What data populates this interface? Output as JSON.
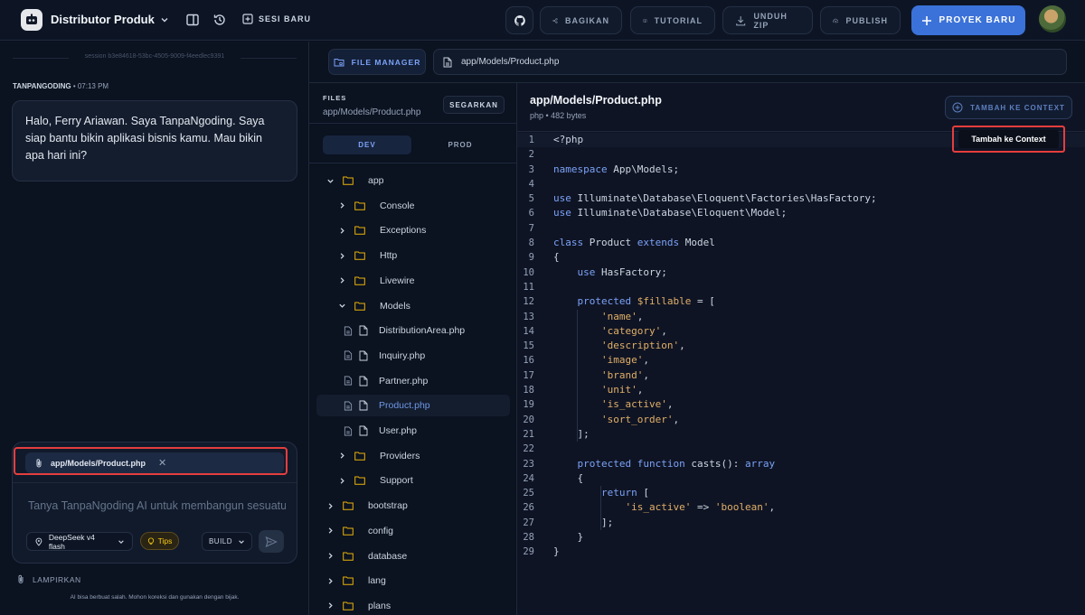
{
  "topbar": {
    "project_title": "Distributor Produk",
    "new_session": "SESI BARU",
    "share": "BAGIKAN",
    "tutorial": "TUTORIAL",
    "download_zip": "UNDUH ZIP",
    "publish": "PUBLISH",
    "new_project": "PROYEK BARU"
  },
  "chat": {
    "session_id": "session b3e84618-53bc-4505-9009-f4eedlec9391",
    "sender": "TANPANGODING",
    "time": "• 07:13 PM",
    "message": "Halo, Ferry Ariawan. Saya TanpaNgoding. Saya siap bantu bikin aplikasi bisnis kamu. Mau bikin apa hari ini?",
    "attachment": "app/Models/Product.php",
    "input_placeholder": "Tanya TanpaNgoding AI untuk membangun sesuatu...",
    "model": "DeepSeek v4 flash",
    "tips": "Tips",
    "mode": "BUILD",
    "attach_label": "LAMPIRKAN",
    "disclaimer": "AI bisa berbuat salah. Mohon koreksi dan gunakan dengan bijak."
  },
  "file_manager": {
    "tab": "FILE MANAGER",
    "path": "app/Models/Product.php",
    "files_label": "FILES",
    "files_path": "app/Models/Product.php",
    "refresh": "SEGARKAN",
    "env_dev": "DEV",
    "env_prod": "PROD",
    "tree": [
      {
        "name": "app",
        "type": "folder",
        "open": true,
        "depth": 0
      },
      {
        "name": "Console",
        "type": "folder",
        "open": false,
        "depth": 1
      },
      {
        "name": "Exceptions",
        "type": "folder",
        "open": false,
        "depth": 1
      },
      {
        "name": "Http",
        "type": "folder",
        "open": false,
        "depth": 1
      },
      {
        "name": "Livewire",
        "type": "folder",
        "open": false,
        "depth": 1
      },
      {
        "name": "Models",
        "type": "folder",
        "open": true,
        "depth": 1
      },
      {
        "name": "DistributionArea.php",
        "type": "file",
        "depth": 2
      },
      {
        "name": "Inquiry.php",
        "type": "file",
        "depth": 2
      },
      {
        "name": "Partner.php",
        "type": "file",
        "depth": 2
      },
      {
        "name": "Product.php",
        "type": "file",
        "depth": 2,
        "active": true
      },
      {
        "name": "User.php",
        "type": "file",
        "depth": 2
      },
      {
        "name": "Providers",
        "type": "folder",
        "open": false,
        "depth": 1
      },
      {
        "name": "Support",
        "type": "folder",
        "open": false,
        "depth": 1
      },
      {
        "name": "bootstrap",
        "type": "folder",
        "open": false,
        "depth": 0
      },
      {
        "name": "config",
        "type": "folder",
        "open": false,
        "depth": 0
      },
      {
        "name": "database",
        "type": "folder",
        "open": false,
        "depth": 0
      },
      {
        "name": "lang",
        "type": "folder",
        "open": false,
        "depth": 0
      },
      {
        "name": "plans",
        "type": "folder",
        "open": false,
        "depth": 0
      }
    ]
  },
  "editor": {
    "title": "app/Models/Product.php",
    "meta": "php • 482 bytes",
    "add_context": "TAMBAH KE CONTEXT",
    "tooltip": "Tambah ke Context",
    "lines": [
      "<?php",
      "",
      "namespace App\\Models;",
      "",
      "use Illuminate\\Database\\Eloquent\\Factories\\HasFactory;",
      "use Illuminate\\Database\\Eloquent\\Model;",
      "",
      "class Product extends Model",
      "{",
      "    use HasFactory;",
      "",
      "    protected $fillable = [",
      "        'name',",
      "        'category',",
      "        'description',",
      "        'image',",
      "        'brand',",
      "        'unit',",
      "        'is_active',",
      "        'sort_order',",
      "    ];",
      "",
      "    protected function casts(): array",
      "    {",
      "        return [",
      "            'is_active' => 'boolean',",
      "        ];",
      "    }",
      "}"
    ]
  },
  "colors": {
    "background": "#0b1220",
    "accent": "#3b72d9",
    "highlight_border": "#e53e3e",
    "keyword": "#7aa2f7",
    "string": "#e0af68"
  },
  "icons": {
    "logo": "robot-logo-icon",
    "sidebar": "sidebar-toggle-icon",
    "history": "history-icon",
    "github": "github-icon",
    "share": "share-icon",
    "tutorial": "book-icon",
    "download": "download-icon",
    "publish": "cloud-upload-icon"
  }
}
